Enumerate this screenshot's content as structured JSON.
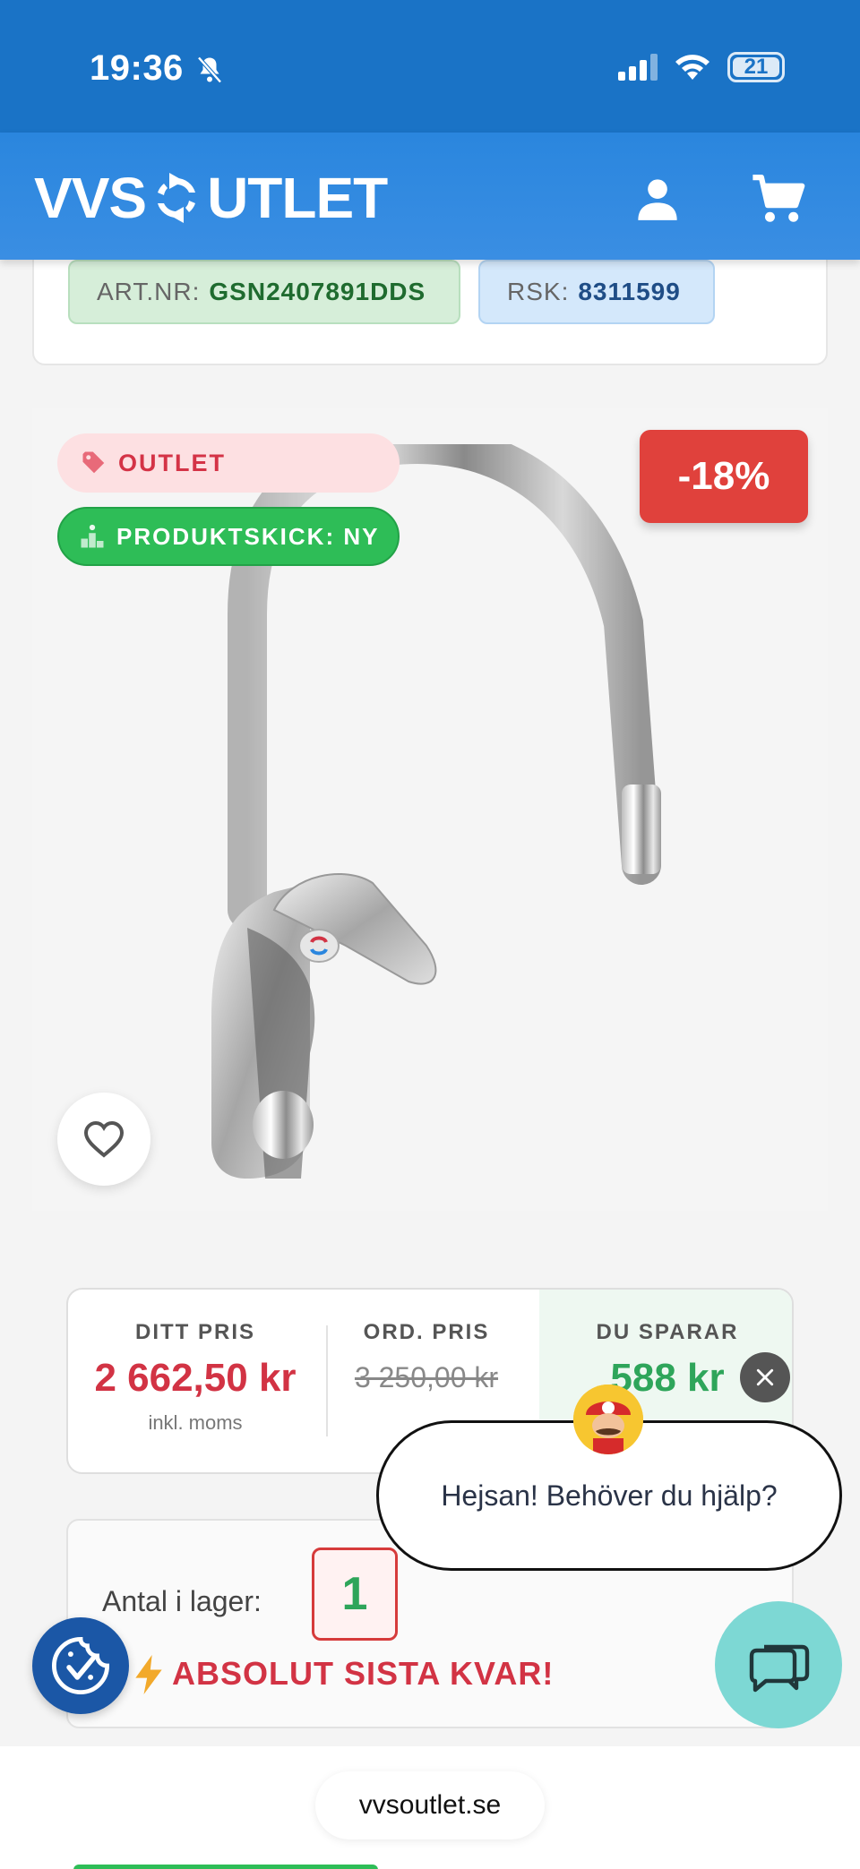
{
  "status_bar": {
    "time": "19:36",
    "battery": "21",
    "icons": [
      "bell-slash-icon",
      "cellular-signal-icon",
      "wifi-icon",
      "battery-icon"
    ]
  },
  "header": {
    "logo_left": "VVS",
    "logo_right": "UTLET",
    "icons": [
      "user-icon",
      "cart-icon"
    ]
  },
  "product_codes": {
    "art_label": "ART.NR:",
    "art_value": "GSN2407891DDS",
    "rsk_label": "RSK:",
    "rsk_value": "8311599"
  },
  "badges": {
    "outlet": "OUTLET",
    "condition": "PRODUKTSKICK: NY",
    "discount": "-18%"
  },
  "price": {
    "yours_label": "DITT PRIS",
    "yours_value": "2 662,50 kr",
    "yours_note": "inkl. moms",
    "ordinary_label": "ORD. PRIS",
    "ordinary_value": "3 250,00 kr",
    "save_label": "DU SPARAR",
    "save_value": "588 kr"
  },
  "stock": {
    "label": "Antal i lager:",
    "count": "1",
    "warning": "ABSOLUT SISTA KVAR!"
  },
  "chat": {
    "greeting": "Hejsan! Behöver du hjälp?"
  },
  "browser": {
    "url": "vvsoutlet.se"
  },
  "colors": {
    "brand_blue": "#2a86de",
    "discount_red": "#e0413c",
    "condition_green": "#2ebd57",
    "price_red": "#d23344",
    "save_green": "#2ea55a"
  }
}
